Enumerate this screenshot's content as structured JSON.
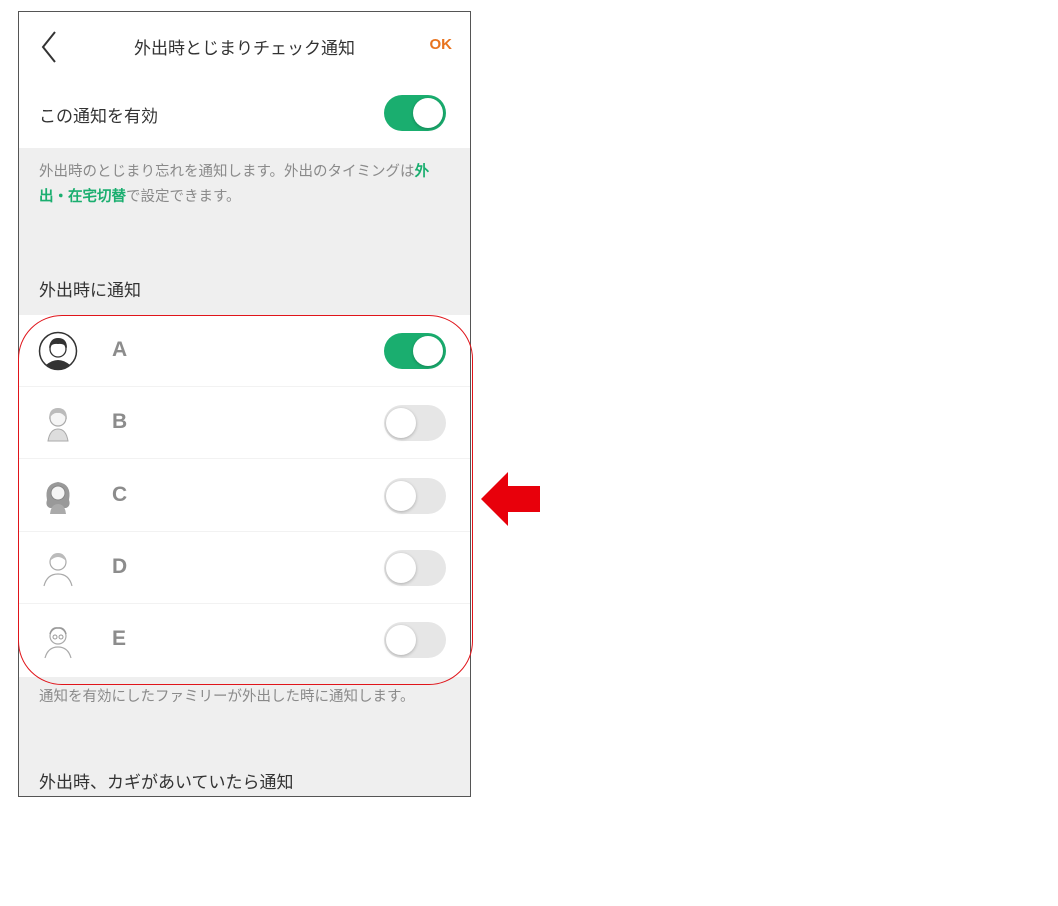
{
  "header": {
    "title": "外出時とじまりチェック通知",
    "ok_label": "OK"
  },
  "enable": {
    "label": "この通知を有効",
    "enabled": true
  },
  "description": {
    "text_before": "外出時のとじまり忘れを通知します。外出のタイミングは",
    "link_text": "外出・在宅切替",
    "text_after": "で設定できます。"
  },
  "section_notify_on_leave": {
    "title": "外出時に通知"
  },
  "members": [
    {
      "name": "A",
      "enabled": true,
      "icon": "avatar-boy-icon"
    },
    {
      "name": "B",
      "enabled": false,
      "icon": "avatar-woman-icon"
    },
    {
      "name": "C",
      "enabled": false,
      "icon": "avatar-girl-icon"
    },
    {
      "name": "D",
      "enabled": false,
      "icon": "avatar-man-icon"
    },
    {
      "name": "E",
      "enabled": false,
      "icon": "avatar-grandpa-icon"
    }
  ],
  "members_note": "通知を有効にしたファミリーが外出した時に通知します。",
  "section_key_open": {
    "title": "外出時、カギがあいていたら通知"
  },
  "colors": {
    "accent_green": "#1aae6f",
    "ok_orange": "#e8731e",
    "highlight_red": "#e0141a"
  }
}
